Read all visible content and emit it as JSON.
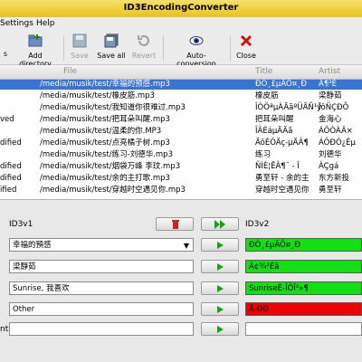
{
  "window": {
    "title": "ID3EncodingConverter"
  },
  "menu": {
    "items": [
      "Settings",
      "Help"
    ]
  },
  "toolbar": {
    "add_directory": "Add directory",
    "save": "Save",
    "save_all": "Save all",
    "revert": "Revert",
    "auto_conversion": "Auto-conversion",
    "close": "Close"
  },
  "list": {
    "headers": {
      "file": "File",
      "title": "Title",
      "artist": "Artist"
    },
    "rows": [
      {
        "status": "",
        "file": "/media/musik/test/幸福的预感.mp3",
        "title": "ÐÒ¸£µÄÔ¤¸Ð",
        "artist": "À¶³É"
      },
      {
        "status": "",
        "file": "/media/musik/test/橡皮筋.mp3",
        "title": "橡皮筋",
        "artist": "梁静茹"
      },
      {
        "status": "",
        "file": "/media/musik/test/我知道你很难过.mp3",
        "title": "ÎÒÖªµÀÄãºÜÄÑ¹ý",
        "artist": "ÏôÑÇÐÕ"
      },
      {
        "status": "ved",
        "file": "/media/musik/test/把耳朵叫醒.mp3",
        "title": "把耳朵叫醒",
        "artist": "金海心"
      },
      {
        "status": "",
        "file": "/media/musik/test/温柔的你.MP3",
        "title": "ÎÂÈáµÄÄã",
        "artist": "ÁÖÒÀÂ×"
      },
      {
        "status": "dified",
        "file": "/media/musik/test/点亮橘子树.mp3",
        "title": "ÄôÉÓÄç-µÄÂ¶",
        "artist": "ÁÖÐÓ¿Éµ"
      },
      {
        "status": "",
        "file": "/media/musik/test/练习-刘德华.mp3",
        "title": "练习",
        "artist": "刘德华"
      },
      {
        "status": "dified",
        "file": "/media/musik/test/烟袋万峰 李玟.mp3",
        "title": "ÑÌÈ¦ËÂ¶¨ - Î",
        "artist": "ÀÇgá"
      },
      {
        "status": "dified",
        "file": "/media/musik/test/余的主打歌.mp3",
        "title": "勇至轩 - 余的主",
        "artist": "东方新投"
      },
      {
        "status": "ified",
        "file": "/media/musik/test/穿越时空遇见你.mp3",
        "title": "穿越时空遇见你",
        "artist": "勇至轩"
      }
    ]
  },
  "editor": {
    "id3v1_label": "ID3v1",
    "id3v2_label": "ID3v2",
    "partial_label": "nt",
    "v1": {
      "title": "幸福的預感",
      "artist": "梁靜茹",
      "album": "Sunrise, 我喜欢",
      "genre": "Other",
      "comment": ""
    },
    "v2": {
      "title": "ÐÒ¸£µÄÔ¤¸Ð",
      "artist": "Á¢¾²Èã",
      "album": "SunriseÈ-ÎÒÏ²»¶",
      "genre": "Â-ÐÐ",
      "comment": ""
    }
  },
  "colors": {
    "selected_row": "#3873d6",
    "field_ok": "#12e012",
    "field_bad": "#f00000",
    "titlebar": "#e8c31a"
  }
}
